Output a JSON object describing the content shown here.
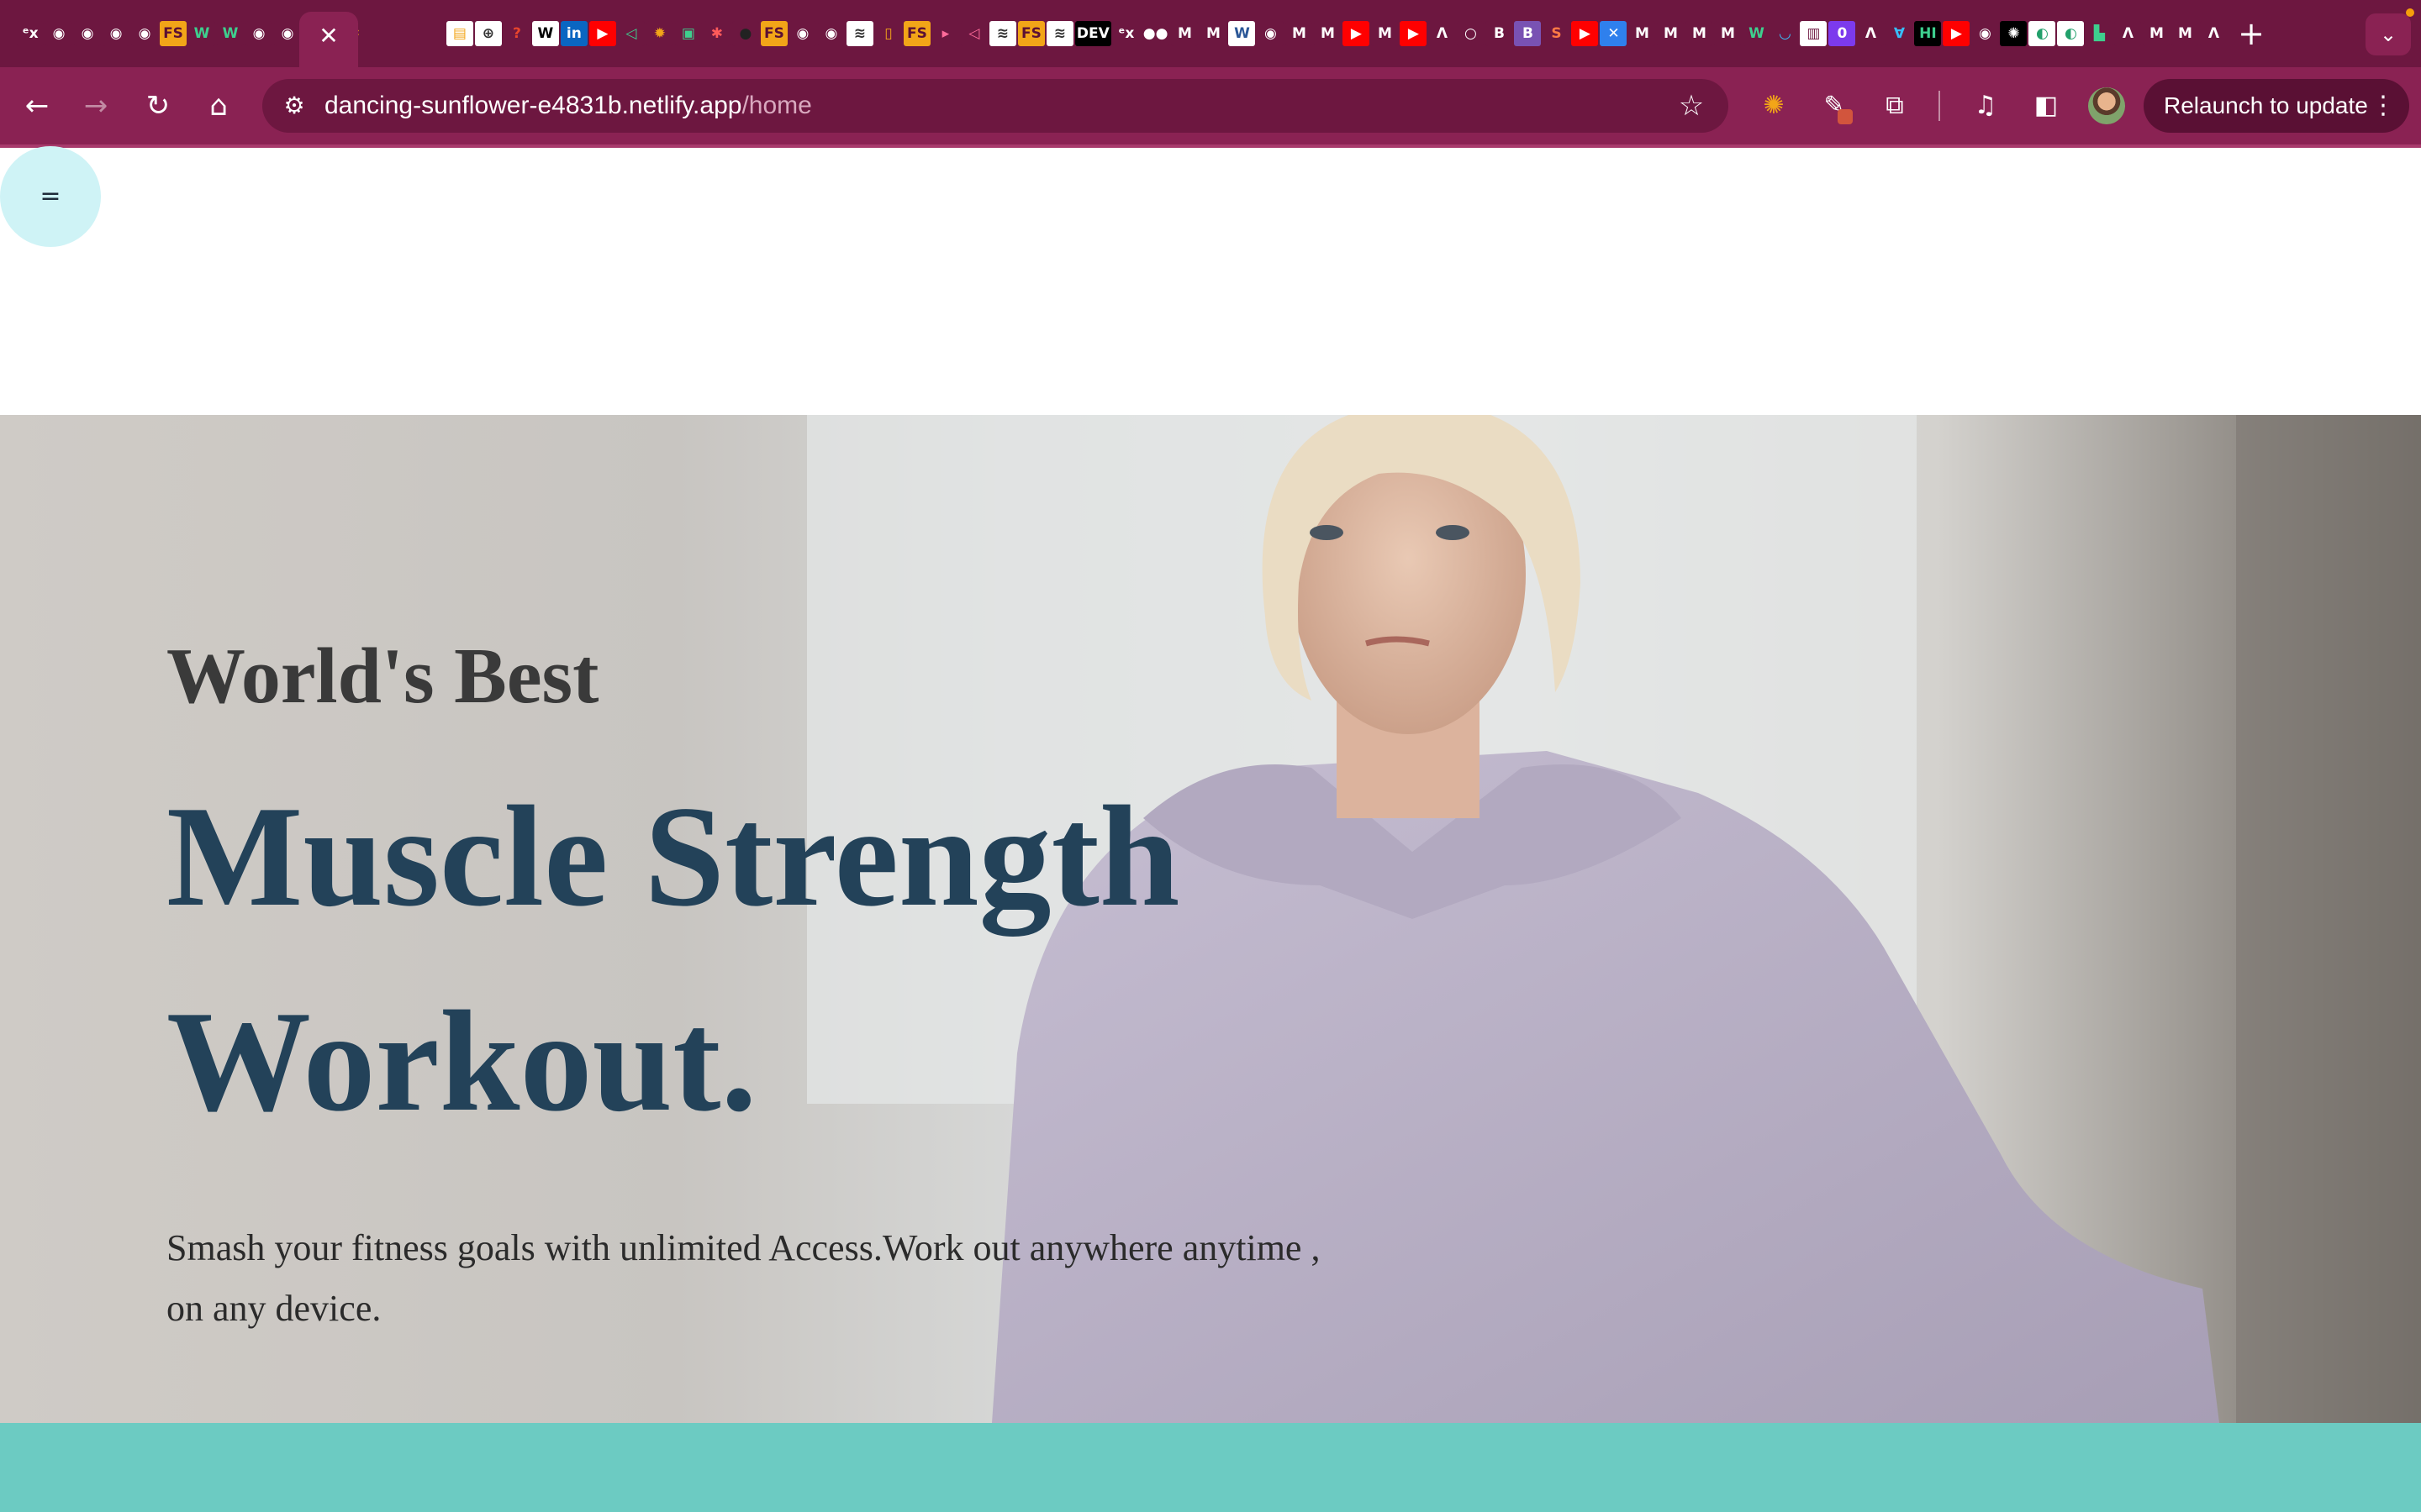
{
  "browser": {
    "active_tab_close": "✕",
    "new_tab": "+",
    "tab_search": "⌄",
    "tab_favicons": [
      {
        "glyph": "ᵉx",
        "bg": "#6d1740",
        "fg": "#ffffff"
      },
      {
        "glyph": "◉",
        "bg": "#6d1740",
        "fg": "#ffffff"
      },
      {
        "glyph": "◉",
        "bg": "#6d1740",
        "fg": "#ffffff"
      },
      {
        "glyph": "◉",
        "bg": "#6d1740",
        "fg": "#ffffff"
      },
      {
        "glyph": "◉",
        "bg": "#6d1740",
        "fg": "#ffffff"
      },
      {
        "glyph": "FS",
        "bg": "#f2a518",
        "fg": "#5a1034"
      },
      {
        "glyph": "W",
        "bg": "#6d1740",
        "fg": "#3ecf8e"
      },
      {
        "glyph": "W",
        "bg": "#6d1740",
        "fg": "#3ecf8e"
      },
      {
        "glyph": "◉",
        "bg": "#6d1740",
        "fg": "#ffffff"
      },
      {
        "glyph": "◉",
        "bg": "#6d1740",
        "fg": "#ffffff"
      },
      {
        "glyph": "DEV",
        "bg": "#000000",
        "fg": "#ffffff"
      },
      {
        "glyph": "✱",
        "bg": "#6d1740",
        "fg": "#f2a518"
      }
    ],
    "tab_favicons_after_active": [
      {
        "glyph": "▤",
        "bg": "#ffffff",
        "fg": "#f2a518"
      },
      {
        "glyph": "⊕",
        "bg": "#ffffff",
        "fg": "#333333"
      },
      {
        "glyph": "?",
        "bg": "#6d1740",
        "fg": "#e8452c"
      },
      {
        "glyph": "W",
        "bg": "#ffffff",
        "fg": "#000000"
      },
      {
        "glyph": "in",
        "bg": "#0a66c2",
        "fg": "#ffffff"
      },
      {
        "glyph": "▶",
        "bg": "#ff0000",
        "fg": "#ffffff"
      },
      {
        "glyph": "◁",
        "bg": "#6d1740",
        "fg": "#3ecf8e"
      },
      {
        "glyph": "✹",
        "bg": "#6d1740",
        "fg": "#f2a518"
      },
      {
        "glyph": "▣",
        "bg": "#6d1740",
        "fg": "#3ecf8e"
      },
      {
        "glyph": "✱",
        "bg": "#6d1740",
        "fg": "#ff5a5a"
      },
      {
        "glyph": "●",
        "bg": "#6d1740",
        "fg": "#222222"
      },
      {
        "glyph": "FS",
        "bg": "#f2a518",
        "fg": "#5a1034"
      },
      {
        "glyph": "◉",
        "bg": "#6d1740",
        "fg": "#ffffff"
      },
      {
        "glyph": "◉",
        "bg": "#6d1740",
        "fg": "#ffffff"
      },
      {
        "glyph": "≋",
        "bg": "#ffffff",
        "fg": "#333333"
      },
      {
        "glyph": "▯",
        "bg": "#6d1740",
        "fg": "#f2a518"
      },
      {
        "glyph": "FS",
        "bg": "#f2a518",
        "fg": "#5a1034"
      },
      {
        "glyph": "▸",
        "bg": "#6d1740",
        "fg": "#ff6b9a"
      },
      {
        "glyph": "◁",
        "bg": "#6d1740",
        "fg": "#ff6b9a"
      },
      {
        "glyph": "≋",
        "bg": "#ffffff",
        "fg": "#333333"
      },
      {
        "glyph": "FS",
        "bg": "#f2a518",
        "fg": "#5a1034"
      },
      {
        "glyph": "≋",
        "bg": "#ffffff",
        "fg": "#333333"
      },
      {
        "glyph": "DEV",
        "bg": "#000000",
        "fg": "#ffffff"
      },
      {
        "glyph": "ᵉx",
        "bg": "#6d1740",
        "fg": "#ffffff"
      },
      {
        "glyph": "●●",
        "bg": "#6d1740",
        "fg": "#ffffff"
      },
      {
        "glyph": "M",
        "bg": "#6d1740",
        "fg": "#ffffff"
      },
      {
        "glyph": "M",
        "bg": "#6d1740",
        "fg": "#ffffff"
      },
      {
        "glyph": "W",
        "bg": "#ffffff",
        "fg": "#2b5797"
      },
      {
        "glyph": "◉",
        "bg": "#6d1740",
        "fg": "#ffffff"
      },
      {
        "glyph": "M",
        "bg": "#6d1740",
        "fg": "#ffffff"
      },
      {
        "glyph": "M",
        "bg": "#6d1740",
        "fg": "#ffffff"
      },
      {
        "glyph": "▶",
        "bg": "#ff0000",
        "fg": "#ffffff"
      },
      {
        "glyph": "M",
        "bg": "#6d1740",
        "fg": "#ffffff"
      },
      {
        "glyph": "▶",
        "bg": "#ff0000",
        "fg": "#ffffff"
      },
      {
        "glyph": "Λ",
        "bg": "#6d1740",
        "fg": "#ffffff"
      },
      {
        "glyph": "○",
        "bg": "#6d1740",
        "fg": "#ffffff"
      },
      {
        "glyph": "B",
        "bg": "#6d1740",
        "fg": "#ffffff"
      },
      {
        "glyph": "B",
        "bg": "#7952b3",
        "fg": "#ffffff"
      },
      {
        "glyph": "S",
        "bg": "#6d1740",
        "fg": "#ff7a45"
      },
      {
        "glyph": "▶",
        "bg": "#ff0000",
        "fg": "#ffffff"
      },
      {
        "glyph": "✕",
        "bg": "#2f80ed",
        "fg": "#ffffff"
      },
      {
        "glyph": "M",
        "bg": "#6d1740",
        "fg": "#ffffff"
      },
      {
        "glyph": "M",
        "bg": "#6d1740",
        "fg": "#ffffff"
      },
      {
        "glyph": "M",
        "bg": "#6d1740",
        "fg": "#ffffff"
      },
      {
        "glyph": "M",
        "bg": "#6d1740",
        "fg": "#ffffff"
      },
      {
        "glyph": "W",
        "bg": "#6d1740",
        "fg": "#3ecf8e"
      },
      {
        "glyph": "◡",
        "bg": "#6d1740",
        "fg": "#38bdf8"
      },
      {
        "glyph": "▥",
        "bg": "#ffffff",
        "fg": "#6d1740"
      },
      {
        "glyph": "0",
        "bg": "#7c3aed",
        "fg": "#ffffff"
      },
      {
        "glyph": "Λ",
        "bg": "#6d1740",
        "fg": "#ffffff"
      },
      {
        "glyph": "∀",
        "bg": "#6d1740",
        "fg": "#38bdf8"
      },
      {
        "glyph": "HI",
        "bg": "#000000",
        "fg": "#3ecf8e"
      },
      {
        "glyph": "▶",
        "bg": "#ff0000",
        "fg": "#ffffff"
      },
      {
        "glyph": "◉",
        "bg": "#6d1740",
        "fg": "#ffffff"
      },
      {
        "glyph": "✺",
        "bg": "#000000",
        "fg": "#ffffff"
      },
      {
        "glyph": "◐",
        "bg": "#ffffff",
        "fg": "#22a06b"
      },
      {
        "glyph": "◐",
        "bg": "#ffffff",
        "fg": "#22a06b"
      },
      {
        "glyph": "▙",
        "bg": "#6d1740",
        "fg": "#3ecf8e"
      },
      {
        "glyph": "Λ",
        "bg": "#6d1740",
        "fg": "#ffffff"
      },
      {
        "glyph": "M",
        "bg": "#6d1740",
        "fg": "#ffffff"
      },
      {
        "glyph": "M",
        "bg": "#6d1740",
        "fg": "#ffffff"
      },
      {
        "glyph": "Λ",
        "bg": "#6d1740",
        "fg": "#ffffff"
      },
      {
        "glyph": "▶",
        "bg": "#ff0000",
        "fg": "#ffffff"
      },
      {
        "glyph": "◉",
        "bg": "#6d1740",
        "fg": "#ffffff"
      },
      {
        "glyph": "▶",
        "bg": "#ff0000",
        "fg": "#ffffff"
      },
      {
        "glyph": "▶",
        "bg": "#ff0000",
        "fg": "#ffffff"
      },
      {
        "glyph": "≋",
        "bg": "#6d1740",
        "fg": "#ffffff"
      },
      {
        "glyph": "Λ",
        "bg": "#6d1740",
        "fg": "#ffffff"
      },
      {
        "glyph": "≋",
        "bg": "#6d1740",
        "fg": "#ffffff"
      },
      {
        "glyph": "▶",
        "bg": "#ff0000",
        "fg": "#ffffff"
      },
      {
        "glyph": "⚛",
        "bg": "#6d1740",
        "fg": "#61dafb"
      },
      {
        "glyph": "⚛",
        "bg": "#6d1740",
        "fg": "#61dafb"
      },
      {
        "glyph": "◉",
        "bg": "#6d1740",
        "fg": "#ffffff"
      }
    ],
    "toolbar": {
      "back": "←",
      "forward": "→",
      "reload": "↻",
      "home": "⌂",
      "site_info": "⚙",
      "url_host": "dancing-sunflower-e4831b.netlify.app",
      "url_path": "/home",
      "bookmark": "☆",
      "extension_1": "✺",
      "extension_2": "✎",
      "extensions_puzzle": "⧉",
      "media_controls": "♫",
      "side_panel": "◧",
      "relaunch_label": "Relaunch to update",
      "relaunch_menu": "⋮"
    },
    "colors": {
      "tabstrip": "#6d1740",
      "toolbar": "#8a2253",
      "omnibox": "#6d1740"
    }
  },
  "page": {
    "menu_toggle_label": "=",
    "hero": {
      "kicker": "World's Best",
      "headline": "Muscle Strength Workout.",
      "subtext": "Smash your fitness goals with unlimited Access.Work out anywhere anytime , on any device."
    },
    "colors": {
      "menu_toggle_bg": "#cff3f6",
      "headline": "#234259",
      "kicker": "#3a3a3a",
      "teal_band": "#6ccbc2",
      "hoodie": "#b9b1c6"
    }
  }
}
